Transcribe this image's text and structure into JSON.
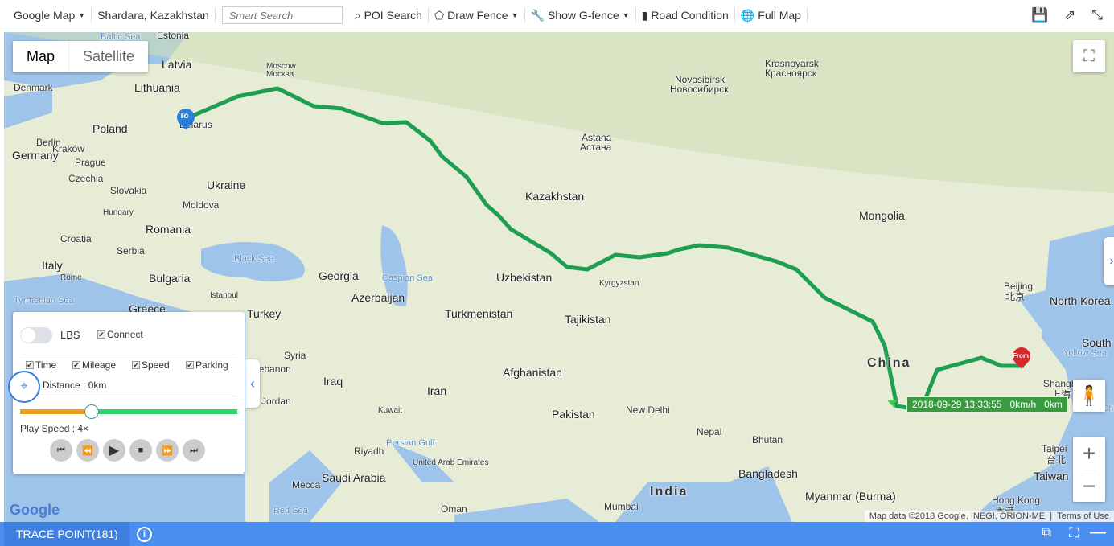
{
  "toolbar": {
    "map_provider": "Google Map",
    "location": "Shardara, Kazakhstan",
    "search_placeholder": "Smart Search",
    "poi_search": "POI Search",
    "draw_fence": "Draw Fence",
    "show_gfence": "Show G-fence",
    "road_condition": "Road Condition",
    "full_map": "Full Map",
    "icons": [
      "save-icon",
      "external-link-icon",
      "fullscreen-icon"
    ]
  },
  "map": {
    "type_map": "Map",
    "type_satellite": "Satellite",
    "attribution": "Map data ©2018 Google, INEGI, ORION-ME",
    "terms": "Terms of Use",
    "logo": "Google",
    "marker_to": "To",
    "marker_from": "From",
    "route_color": "#1e9e50",
    "tooltip": {
      "time": "2018-09-29 13:33:55",
      "speed": "0km/h",
      "mileage": "0km"
    },
    "labels": [
      "Baltic Sea",
      "Estonia",
      "Latvia",
      "Denmark",
      "Lithuania",
      "Moscow",
      "Москва",
      "Belarus",
      "Poland",
      "Berlin",
      "Germany",
      "Prague",
      "Czechia",
      "Slovakia",
      "Hungary",
      "Ukraine",
      "Moldova",
      "Romania",
      "Croatia",
      "Serbia",
      "Italy",
      "Rome",
      "Bulgaria",
      "Tyrrhenian Sea",
      "Greece",
      "Black Sea",
      "Istanbul",
      "Turkey",
      "Georgia",
      "Azerbaijan",
      "Caspian Sea",
      "Syria",
      "Lebanon",
      "Iraq",
      "Jordan",
      "Iran",
      "Kuwait",
      "Persian Gulf",
      "Riyadh",
      "Saudi Arabia",
      "Mecca",
      "Red Sea",
      "Oman",
      "United Arab Emirates",
      "Turkmenistan",
      "Uzbekistan",
      "Kyrgyzstan",
      "Tajikistan",
      "Afghanistan",
      "Pakistan",
      "New Delhi",
      "India",
      "Mumbai",
      "Nepal",
      "Bhutan",
      "Bangladesh",
      "Myanmar (Burma)",
      "Kazakhstan",
      "Astana",
      "Астана",
      "Novosibirsk",
      "Новосибирск",
      "Krasnoyarsk",
      "Красноярск",
      "Mongolia",
      "China",
      "Beijing",
      "北京",
      "North Korea",
      "South Korea",
      "Yellow Sea",
      "Shanghai",
      "上海",
      "East China Sea",
      "Taipei",
      "台北",
      "Taiwan",
      "Hong Kong",
      "香港",
      "Kraków"
    ]
  },
  "panel": {
    "lbs_label": "LBS",
    "lbs_on": false,
    "connect": "Connect",
    "time": "Time",
    "mileage": "Mileage",
    "speed": "Speed",
    "parking": "Parking",
    "distance": "Distance : 0km",
    "progress_percent": 33,
    "play_speed": "Play Speed : 4×",
    "buttons": [
      "first",
      "rewind",
      "play",
      "stop",
      "fast-forward",
      "last"
    ]
  },
  "bottom": {
    "tab": "TRACE POINT(181)"
  }
}
